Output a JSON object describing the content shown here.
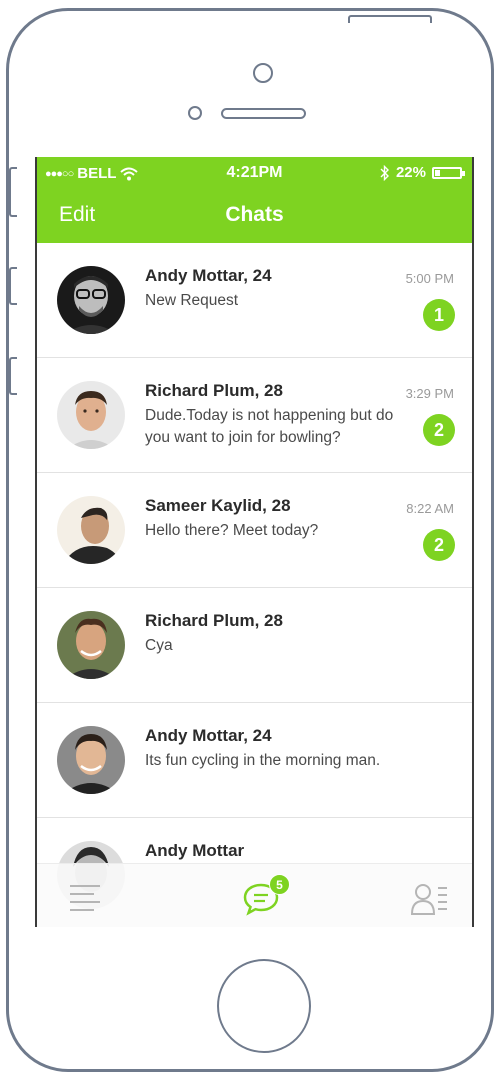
{
  "status_bar": {
    "signal": "●●●○○",
    "carrier": "BELL",
    "time": "4:21PM",
    "battery_text": "22%",
    "battery_level": 0.22
  },
  "nav": {
    "edit_label": "Edit",
    "title": "Chats"
  },
  "chats": [
    {
      "name": "Andy Mottar, 24",
      "message": "New Request",
      "time": "5:00 PM",
      "unread": "1"
    },
    {
      "name": "Richard Plum, 28",
      "message": "Dude.Today is not happening but do you want to join for bowling?",
      "time": "3:29 PM",
      "unread": "2"
    },
    {
      "name": "Sameer Kaylid, 28",
      "message": "Hello there? Meet today?",
      "time": "8:22 AM",
      "unread": "2"
    },
    {
      "name": "Richard Plum, 28",
      "message": "Cya",
      "time": "",
      "unread": ""
    },
    {
      "name": "Andy Mottar, 24",
      "message": "Its fun cycling in the morning man.",
      "time": "",
      "unread": ""
    },
    {
      "name": "Andy Mottar",
      "message": "",
      "time": "",
      "unread": ""
    }
  ],
  "tabbar": {
    "chats_badge": "5"
  },
  "icons": {
    "menu": "menu-lines-icon",
    "chats": "chat-bubble-icon",
    "contacts": "contacts-icon"
  },
  "colors": {
    "accent": "#7ed321",
    "frame": "#6f7a8c"
  }
}
